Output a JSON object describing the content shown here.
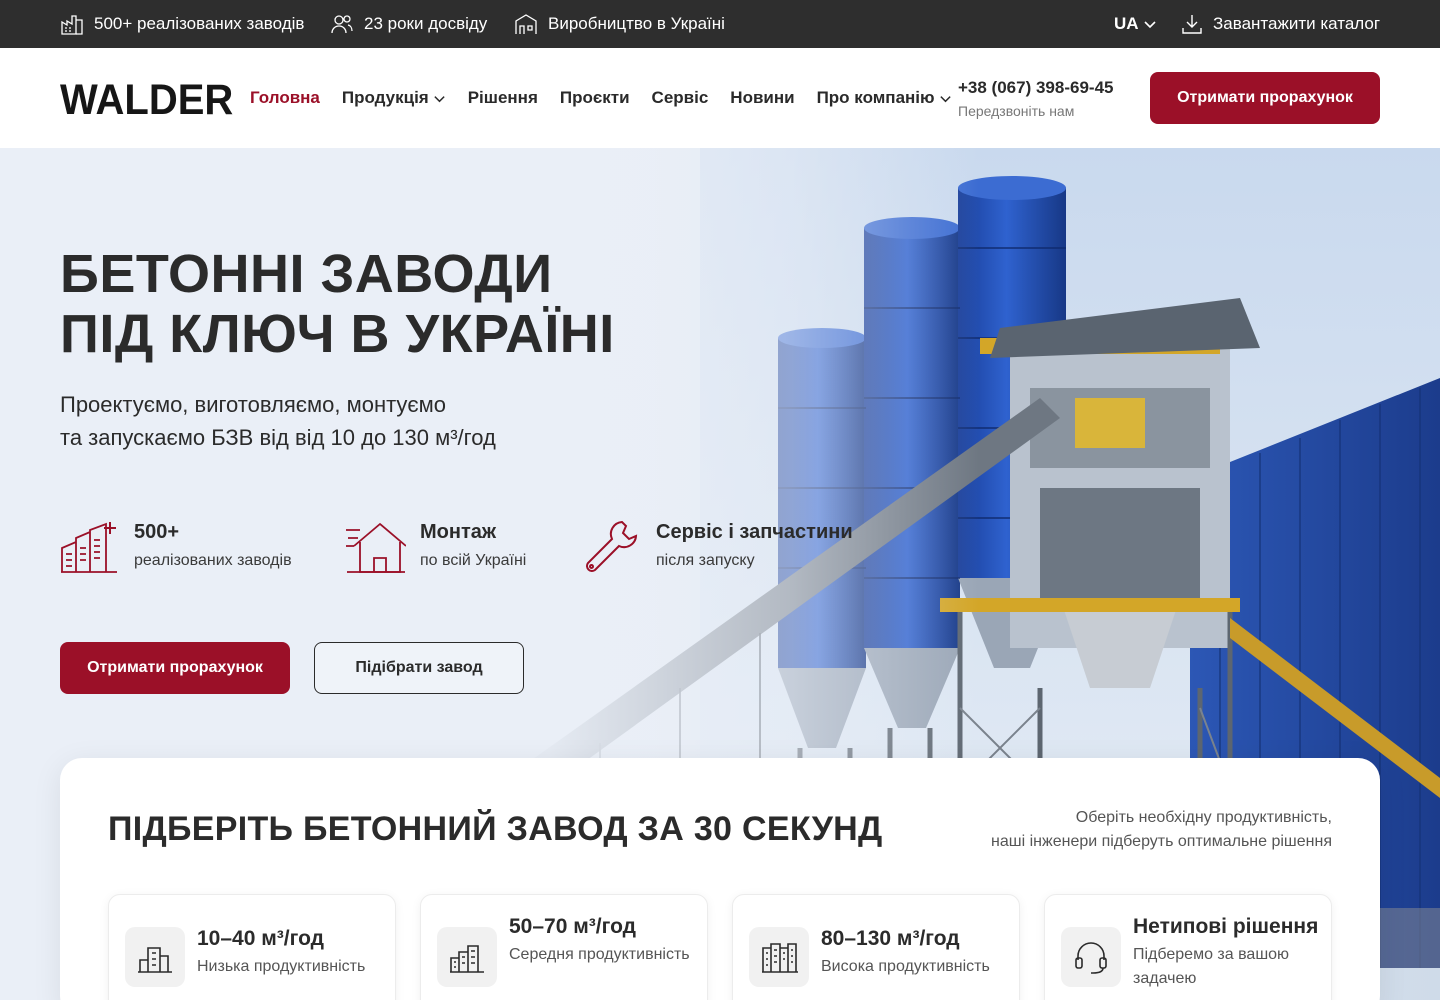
{
  "topbar": {
    "items": [
      {
        "icon": "factory-icon",
        "label": "500+ реалізованих заводів"
      },
      {
        "icon": "people-icon",
        "label": "23 роки досвіду"
      },
      {
        "icon": "production-icon",
        "label": "Виробництво в Україні"
      }
    ],
    "language": "UA",
    "catalog_label": "Завантажити каталог"
  },
  "header": {
    "logo": "WALDER",
    "nav": [
      {
        "label": "Головна",
        "active": true
      },
      {
        "label": "Продукція",
        "dropdown": true
      },
      {
        "label": "Рішення"
      },
      {
        "label": "Проєкти"
      },
      {
        "label": "Сервіс"
      },
      {
        "label": "Новини"
      },
      {
        "label": "Про компанію",
        "dropdown": true
      }
    ],
    "phone": "+38 (067) 398-69-45",
    "phone_sub": "Передзвоніть нам",
    "cta": "Отримати прорахунок"
  },
  "hero": {
    "title_line1": "БЕТОННІ ЗАВОДИ",
    "title_line2": "ПІД КЛЮЧ В УКРАЇНІ",
    "subtitle_line1": "Проектуємо, виготовляємо, монтуємо",
    "subtitle_line2": "та запускаємо БЗВ від від 10 до 130 м³/год",
    "features": [
      {
        "icon": "buildings-icon",
        "title": "500+",
        "subtitle": "реалізованих заводів"
      },
      {
        "icon": "house-delivery-icon",
        "title": "Монтаж",
        "subtitle": "по всій Україні"
      },
      {
        "icon": "wrench-icon",
        "title": "Сервіс і запчастини",
        "subtitle": "після запуску"
      }
    ],
    "primary_button": "Отримати прорахунок",
    "secondary_button": "Підібрати завод"
  },
  "selector": {
    "title": "ПІДБЕРІТЬ БЕТОННИЙ ЗАВОД ЗА 30 СЕКУНД",
    "desc_line1": "Оберіть необхідну продуктивність,",
    "desc_line2": "наші інженери підберуть оптимальне рішення",
    "options": [
      {
        "icon": "small-building-icon",
        "title": "10–40 м³/год",
        "subtitle": "Низька продуктивність"
      },
      {
        "icon": "medium-building-icon",
        "title": "50–70 м³/год",
        "subtitle": "Середня продуктивність"
      },
      {
        "icon": "large-building-icon",
        "title": "80–130 м³/год",
        "subtitle": "Висока продуктивність"
      },
      {
        "icon": "headset-icon",
        "title": "Нетипові рішення",
        "subtitle": "Підберемо за вашою задачею"
      }
    ]
  },
  "colors": {
    "brand": "#9b1028",
    "topbar": "#2e2e2e",
    "silo_blue": "#1f4fb8"
  }
}
